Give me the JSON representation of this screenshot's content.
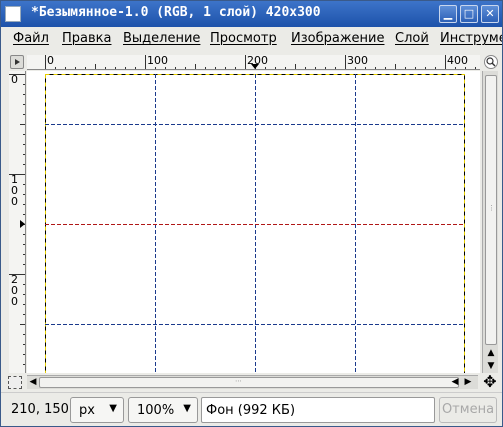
{
  "window": {
    "title": "*Безымянное-1.0 (RGB, 1 слой) 420x300",
    "minimize_glyph": "▁",
    "maximize_glyph": "□",
    "close_glyph": "✕"
  },
  "menu": {
    "items": [
      "Файл",
      "Правка",
      "Выделение",
      "Просмотр",
      "Изображение",
      "Слой",
      "Инструменты"
    ]
  },
  "ruler": {
    "horizontal_labels": [
      "0",
      "100",
      "200",
      "300",
      "400"
    ],
    "vertical_labels": [
      [
        "0"
      ],
      [
        "1",
        "0",
        "0"
      ],
      [
        "2",
        "0",
        "0"
      ]
    ]
  },
  "image": {
    "width": 420,
    "height": 300,
    "vertical_guides": [
      110,
      210,
      310
    ],
    "horizontal_guides": [
      50,
      150,
      250
    ],
    "active_guide": 150,
    "guide_color": "#1b3a8c",
    "active_guide_color": "#b01818",
    "selection_color": "#e8d000"
  },
  "status": {
    "coords": "210, 150",
    "unit": "px",
    "zoom": "100%",
    "layer_info": "Фон (992 КБ)",
    "cancel_label": "Отмена"
  },
  "icons": {
    "corner": "quick-menu-icon",
    "nav": "navigate-icon",
    "move": "move-cross-icon",
    "quickmask": "quick-mask-icon"
  }
}
